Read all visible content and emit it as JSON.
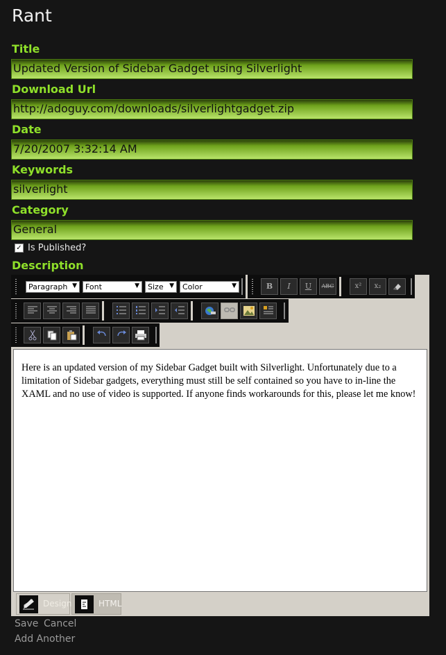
{
  "page_title": "Rant",
  "fields": {
    "title": {
      "label": "Title",
      "value": "Updated Version of Sidebar Gadget using Silverlight"
    },
    "download": {
      "label": "Download Url",
      "value": "http://adoguy.com/downloads/silverlightgadget.zip"
    },
    "date": {
      "label": "Date",
      "value": "7/20/2007 3:32:14 AM"
    },
    "keywords": {
      "label": "Keywords",
      "value": "silverlight"
    },
    "category": {
      "label": "Category",
      "value": "General"
    }
  },
  "published": {
    "label": "Is Published?",
    "checked": true,
    "mark": "✓"
  },
  "description": {
    "label": "Description",
    "paragraph_select": "Paragraph",
    "font_select": "Font",
    "size_select": "Size",
    "color_select": "Color",
    "toolbar_text": {
      "bold": "B",
      "italic": "I",
      "underline": "U",
      "strike": "ABC",
      "sup": "x²",
      "sub": "x₂"
    },
    "content": "Here is an updated version of my Sidebar Gadget built with Silverlight.  Unfortunately due to a limitation of Sidebar gadgets, everything must still be self contained so you have to in-line the XAML and no use of video is supported.  If anyone finds workarounds for this, please let me know!",
    "tabs": {
      "design": "Design",
      "html": "HTML"
    }
  },
  "actions": {
    "save": "Save",
    "cancel": "Cancel",
    "add_another": "Add Another"
  },
  "colors": {
    "accent": "#8fe02a",
    "background": "#151515",
    "field_gradient_end": "#b9e46a"
  }
}
